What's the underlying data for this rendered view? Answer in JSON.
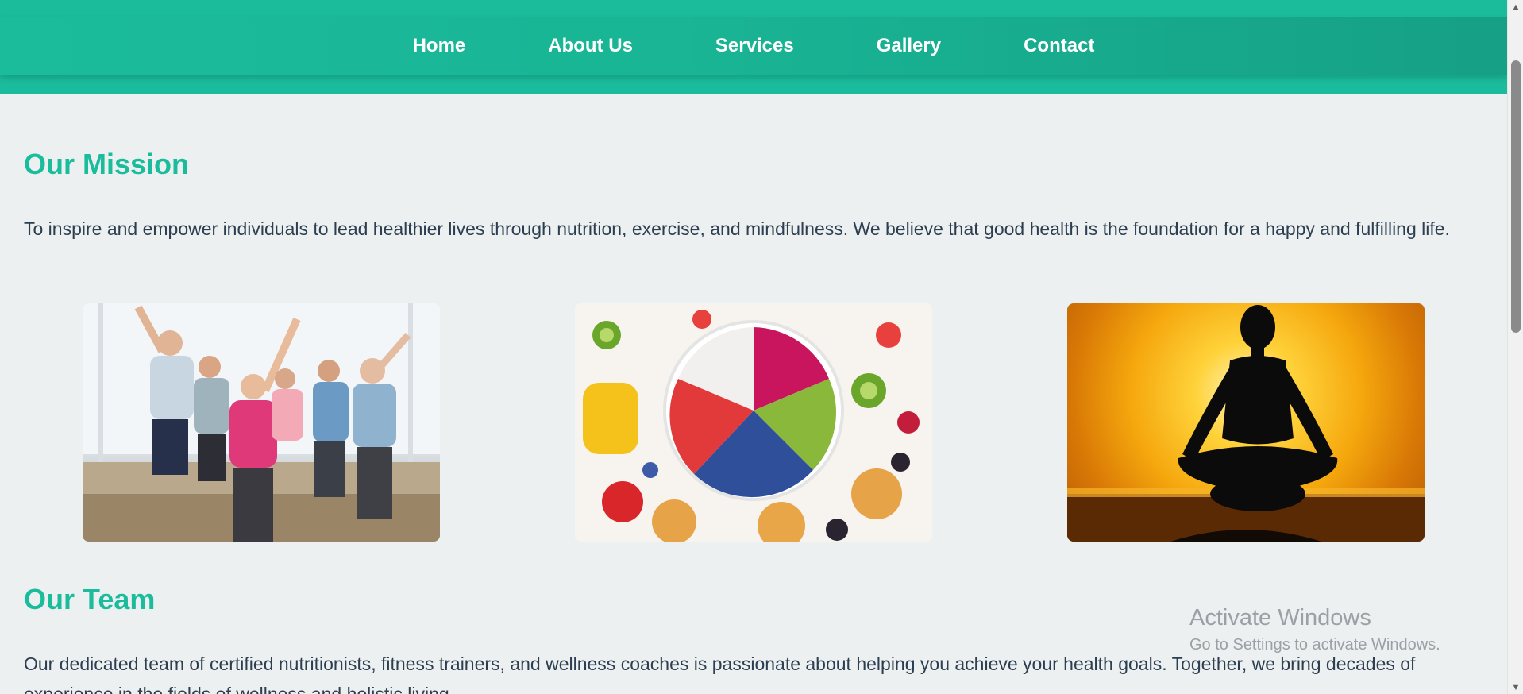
{
  "nav": {
    "items": [
      {
        "label": "Home"
      },
      {
        "label": "About Us"
      },
      {
        "label": "Services"
      },
      {
        "label": "Gallery"
      },
      {
        "label": "Contact"
      }
    ]
  },
  "mission": {
    "title": "Our Mission",
    "text": "To inspire and empower individuals to lead healthier lives through nutrition, exercise, and mindfulness. We believe that good health is the foundation for a happy and fulfilling life."
  },
  "gallery": {
    "images": [
      {
        "name": "exercise-class-photo"
      },
      {
        "name": "fruit-bowl-photo"
      },
      {
        "name": "meditation-silhouette-photo"
      }
    ]
  },
  "team": {
    "title": "Our Team",
    "text": "Our dedicated team of certified nutritionists, fitness trainers, and wellness coaches is passionate about helping you achieve your health goals. Together, we bring decades of experience in the fields of wellness and holistic living."
  },
  "watermark": {
    "title": "Activate Windows",
    "subtitle": "Go to Settings to activate Windows."
  },
  "colors": {
    "accent": "#1abc9c",
    "accent_dark": "#16a085",
    "background": "#ecf0f1",
    "text": "#2c3e50"
  }
}
